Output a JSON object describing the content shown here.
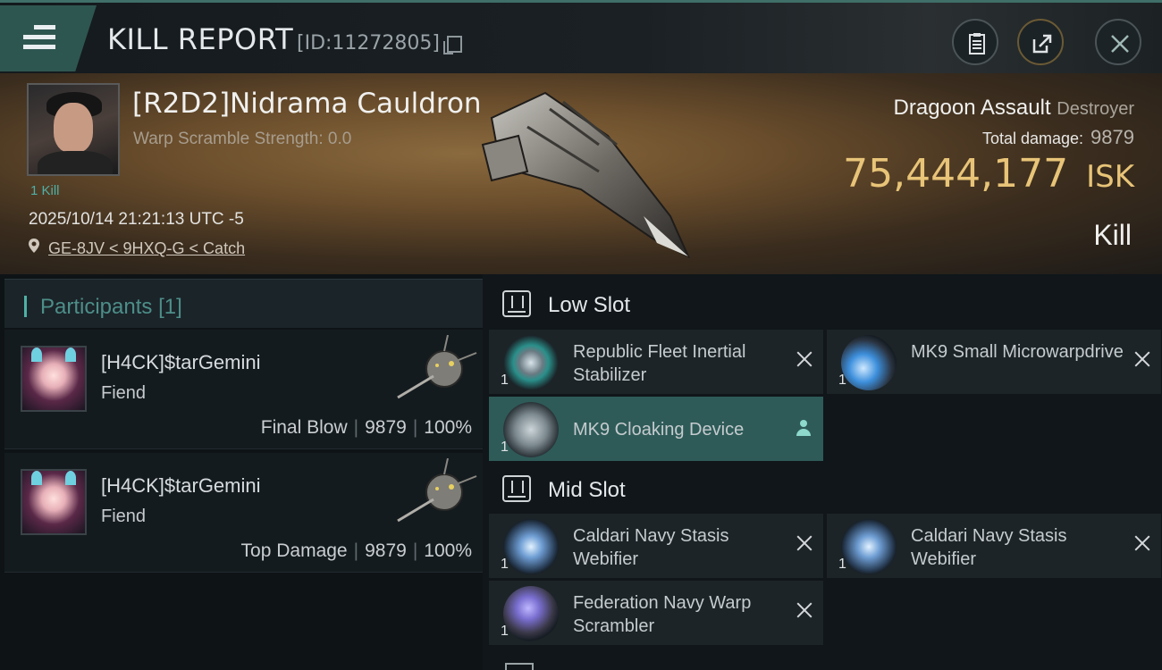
{
  "header": {
    "title": "KILL REPORT",
    "report_id": "[ID:11272805]"
  },
  "victim": {
    "name": "[R2D2]Nidrama Cauldron",
    "warp_scramble": "Warp Scramble Strength: 0.0",
    "kill_count": "1 Kill",
    "datetime": "2025/10/14 21:21:13 UTC -5",
    "location": "GE-8JV < 9HXQ-G < Catch",
    "ship": "Dragoon Assault",
    "ship_class": "Destroyer",
    "total_damage_label": "Total damage:",
    "total_damage_value": "9879",
    "isk_value": "75,444,177",
    "isk_unit": "ISK",
    "result": "Kill"
  },
  "participants": {
    "title": "Participants",
    "count": "[1]",
    "cards": [
      {
        "name": "[H4CK]$tarGemini",
        "ship": "Fiend",
        "role": "Final Blow",
        "damage": "9879",
        "percent": "100%"
      },
      {
        "name": "[H4CK]$tarGemini",
        "ship": "Fiend",
        "role": "Top Damage",
        "damage": "9879",
        "percent": "100%"
      }
    ]
  },
  "fittings": {
    "low_slot": {
      "title": "Low Slot",
      "items": [
        {
          "name": "Republic Fleet Inertial Stabilizer",
          "qty": "1",
          "icon": "inertial-stabilizer-icon"
        },
        {
          "name": "MK9 Small Microwarpdrive",
          "qty": "1",
          "icon": "microwarpdrive-icon"
        },
        {
          "name": "MK9 Cloaking Device",
          "qty": "1",
          "icon": "cloaking-device-icon"
        }
      ]
    },
    "mid_slot": {
      "title": "Mid Slot",
      "items": [
        {
          "name": "Caldari Navy Stasis Webifier",
          "qty": "1",
          "icon": "stasis-webifier-icon"
        },
        {
          "name": "Caldari Navy Stasis Webifier",
          "qty": "1",
          "icon": "stasis-webifier-icon"
        },
        {
          "name": "Federation Navy Warp Scrambler",
          "qty": "1",
          "icon": "warp-scrambler-icon"
        }
      ]
    }
  },
  "colors": {
    "accent_teal": "#4fb0a6",
    "isk_gold": "#e8c478",
    "selected_row": "#2e5b58"
  }
}
